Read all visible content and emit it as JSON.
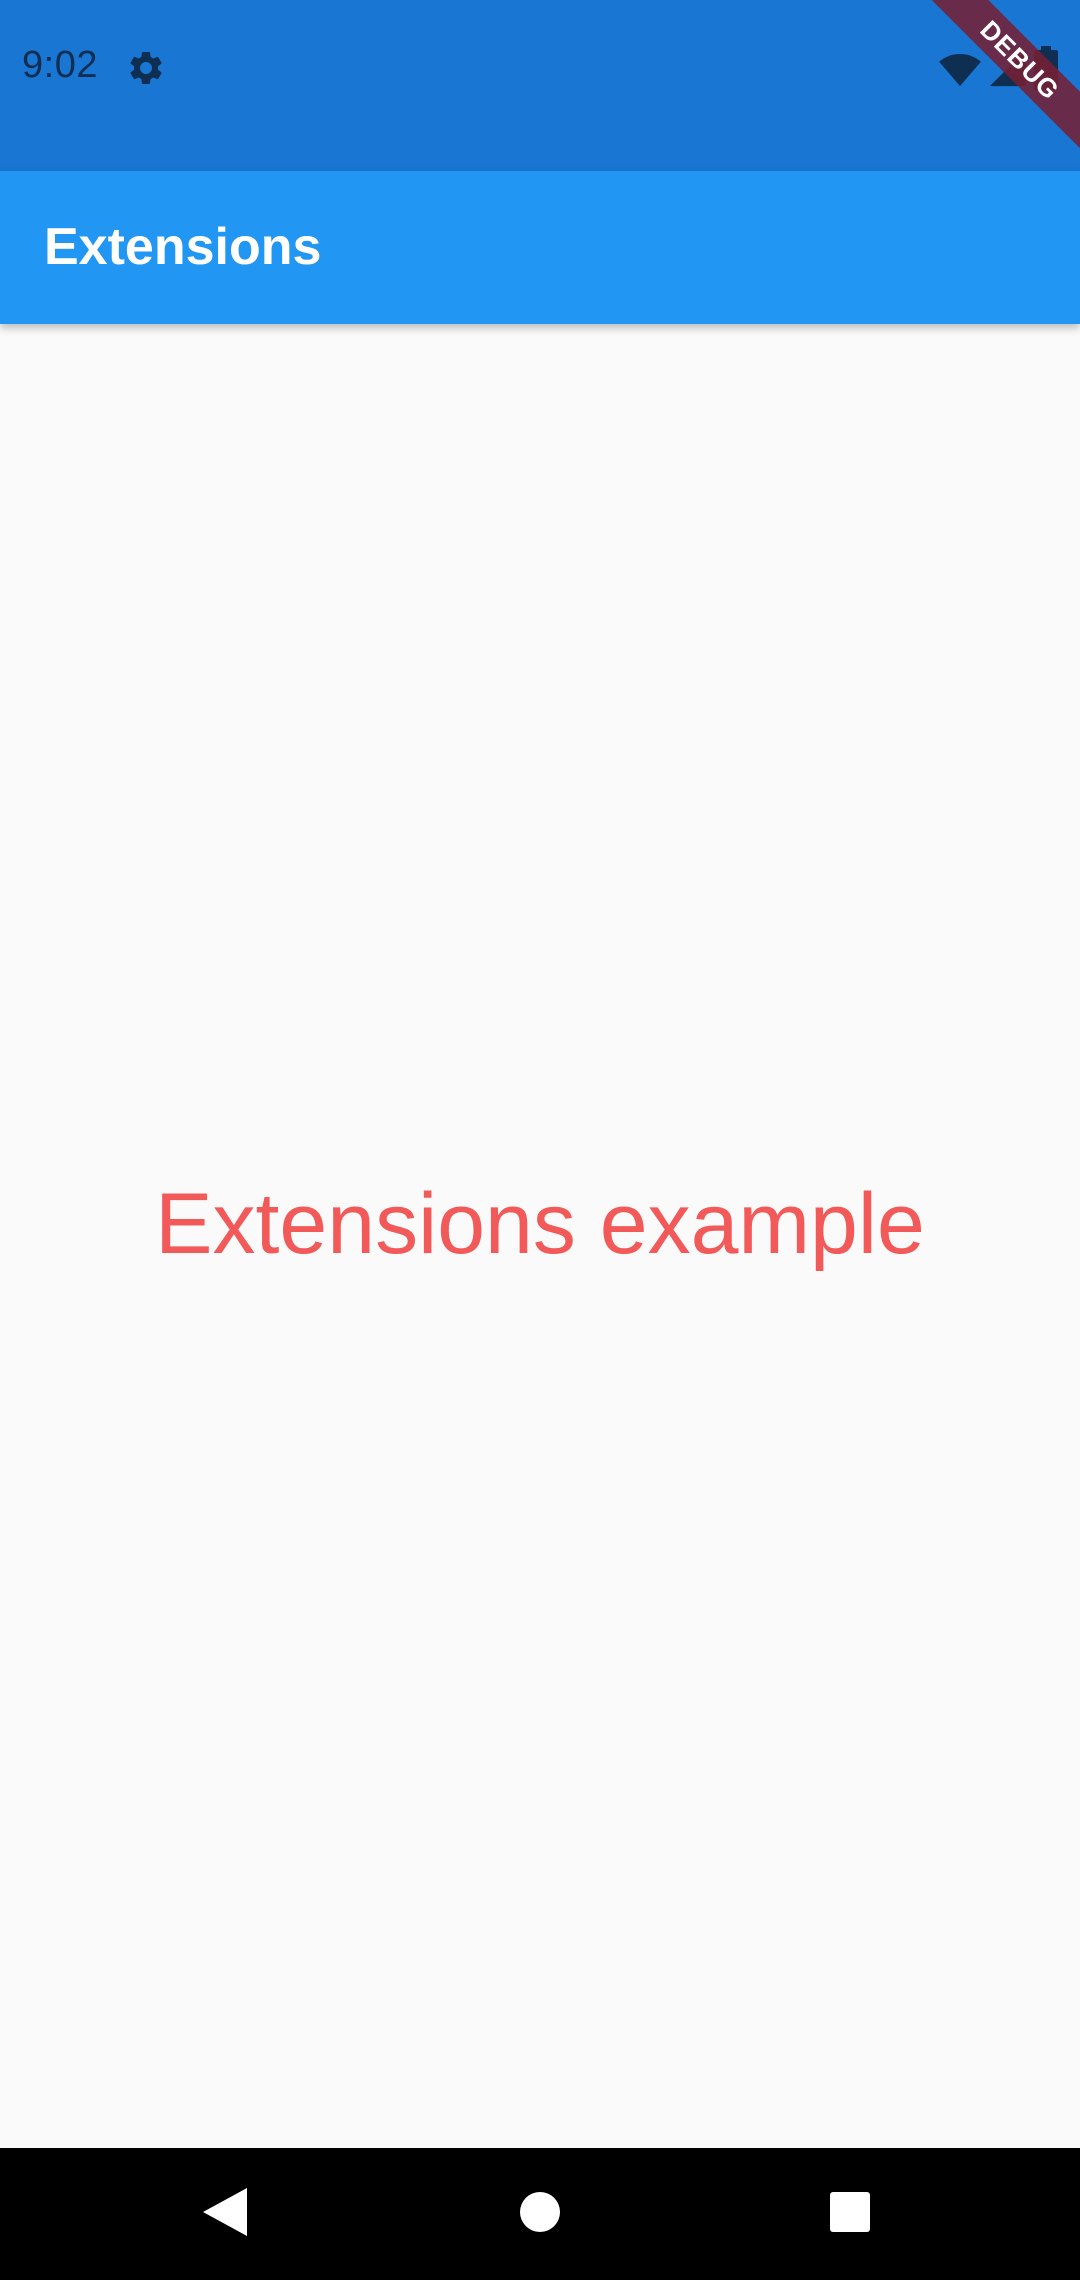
{
  "status_bar": {
    "time": "9:02",
    "icons": [
      "gear-icon",
      "wifi-icon",
      "cellular-signal-icon",
      "battery-icon"
    ],
    "background": "#1976d2"
  },
  "debug_banner": {
    "label": "DEBUG"
  },
  "app_bar": {
    "title": "Extensions",
    "background": "#2196f3"
  },
  "main": {
    "text": "Extensions example",
    "text_color": "#f25a5a"
  },
  "nav_bar": {
    "buttons": [
      "back-icon",
      "home-icon",
      "recents-icon"
    ],
    "background": "#000000"
  }
}
